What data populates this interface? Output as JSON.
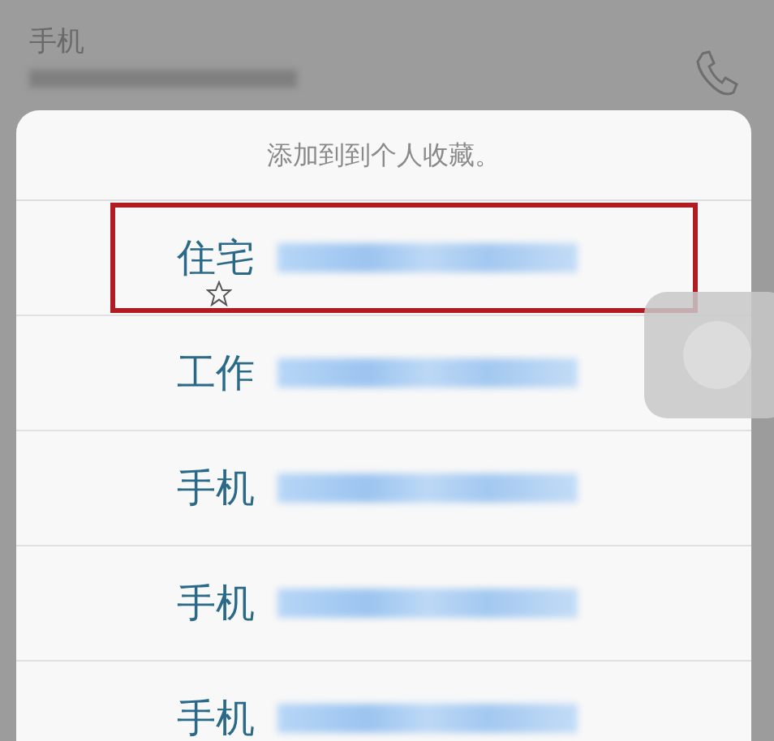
{
  "background_contact": {
    "label": "手机"
  },
  "sheet": {
    "title": "添加到到个人收藏。",
    "options": [
      {
        "label": "住宅",
        "starred": true,
        "highlighted": true
      },
      {
        "label": "工作",
        "starred": false,
        "highlighted": false
      },
      {
        "label": "手机",
        "starred": false,
        "highlighted": false
      },
      {
        "label": "手机",
        "starred": false,
        "highlighted": false
      },
      {
        "label": "手机",
        "starred": false,
        "highlighted": false
      }
    ]
  }
}
